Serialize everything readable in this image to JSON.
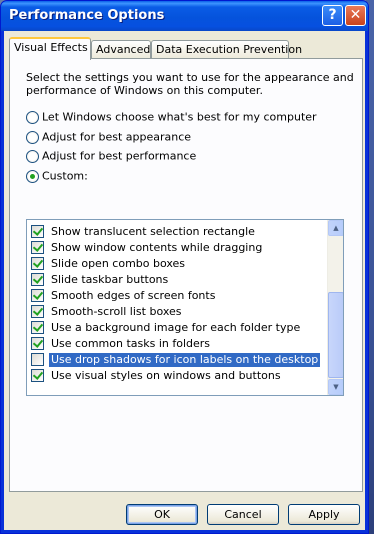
{
  "window": {
    "title": "Performance Options",
    "help_glyph": "?",
    "close_glyph": "✕"
  },
  "tabs": [
    {
      "label": "Visual Effects",
      "active": true
    },
    {
      "label": "Advanced",
      "active": false
    },
    {
      "label": "Data Execution Prevention",
      "active": false
    }
  ],
  "visual_effects": {
    "intro": "Select the settings you want to use for the appearance and performance of Windows on this computer.",
    "options": [
      {
        "label": "Let Windows choose what's best for my computer",
        "selected": false
      },
      {
        "label": "Adjust for best appearance",
        "selected": false
      },
      {
        "label": "Adjust for best performance",
        "selected": false
      },
      {
        "label": "Custom:",
        "selected": true
      }
    ],
    "settings": [
      {
        "label": "Show translucent selection rectangle",
        "checked": true,
        "highlighted": false
      },
      {
        "label": "Show window contents while dragging",
        "checked": true,
        "highlighted": false
      },
      {
        "label": "Slide open combo boxes",
        "checked": true,
        "highlighted": false
      },
      {
        "label": "Slide taskbar buttons",
        "checked": true,
        "highlighted": false
      },
      {
        "label": "Smooth edges of screen fonts",
        "checked": true,
        "highlighted": false
      },
      {
        "label": "Smooth-scroll list boxes",
        "checked": true,
        "highlighted": false
      },
      {
        "label": "Use a background image for each folder type",
        "checked": true,
        "highlighted": false
      },
      {
        "label": "Use common tasks in folders",
        "checked": true,
        "highlighted": false
      },
      {
        "label": "Use drop shadows for icon labels on the desktop",
        "checked": false,
        "highlighted": true
      },
      {
        "label": "Use visual styles on windows and buttons",
        "checked": true,
        "highlighted": false
      }
    ]
  },
  "buttons": {
    "ok": "OK",
    "cancel": "Cancel",
    "apply": "Apply"
  },
  "colors": {
    "title_bar": "#0553dc",
    "selection": "#316ac5",
    "check": "#21a121",
    "default_button_focus": "#7ba2e7"
  }
}
